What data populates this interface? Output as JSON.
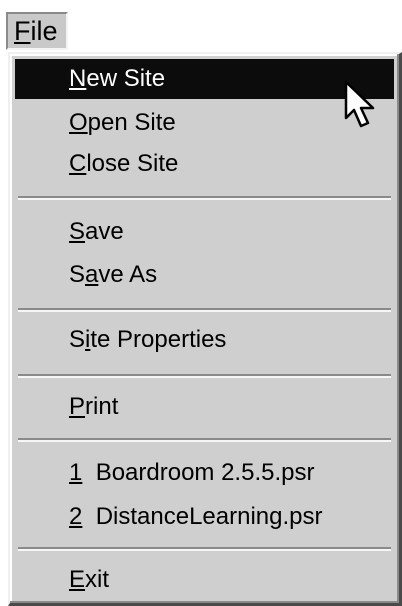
{
  "menubar": {
    "file": {
      "label": "File",
      "accel_char": "F",
      "rest": "ile"
    }
  },
  "file_menu": {
    "items": [
      {
        "id": "new-site",
        "before": "",
        "accel": "N",
        "after": "ew Site",
        "highlighted": true
      },
      {
        "id": "open-site",
        "before": "",
        "accel": "O",
        "after": "pen Site"
      },
      {
        "id": "close-site",
        "before": "",
        "accel": "C",
        "after": "lose Site"
      },
      {
        "id": "save",
        "before": "",
        "accel": "S",
        "after": "ave"
      },
      {
        "id": "save-as",
        "before": "S",
        "accel": "a",
        "after": "ve As"
      },
      {
        "id": "site-properties",
        "before": "S",
        "accel": "i",
        "after": "te Properties"
      },
      {
        "id": "print",
        "before": "",
        "accel": "P",
        "after": "rint"
      },
      {
        "id": "recent-1",
        "before": "",
        "accel": "1",
        "after": "  Boardroom 2.5.5.psr"
      },
      {
        "id": "recent-2",
        "before": "",
        "accel": "2",
        "after": "  DistanceLearning.psr"
      },
      {
        "id": "exit",
        "before": "",
        "accel": "E",
        "after": "xit"
      }
    ]
  },
  "colors": {
    "menu_bg": "#cfcfcf",
    "highlight_bg": "#0c0c0c",
    "highlight_fg": "#ffffff"
  },
  "cursor": {
    "icon": "arrow-cursor-icon"
  }
}
